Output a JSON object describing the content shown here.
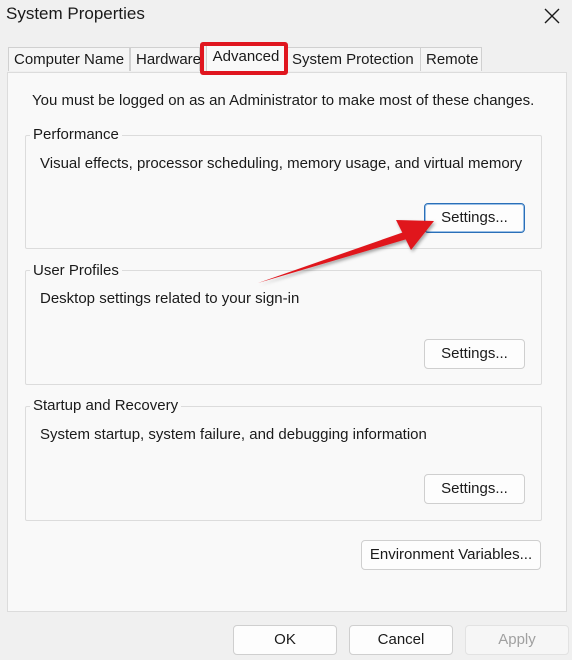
{
  "window": {
    "title": "System Properties"
  },
  "tabs": [
    {
      "label": "Computer Name"
    },
    {
      "label": "Hardware"
    },
    {
      "label": "Advanced"
    },
    {
      "label": "System Protection"
    },
    {
      "label": "Remote"
    }
  ],
  "active_tab": "Advanced",
  "admin_note": "You must be logged on as an Administrator to make most of these changes.",
  "groups": {
    "performance": {
      "label": "Performance",
      "description": "Visual effects, processor scheduling, memory usage, and virtual memory",
      "button": "Settings..."
    },
    "user_profiles": {
      "label": "User Profiles",
      "description": "Desktop settings related to your sign-in",
      "button": "Settings..."
    },
    "startup_recovery": {
      "label": "Startup and Recovery",
      "description": "System startup, system failure, and debugging information",
      "button": "Settings..."
    }
  },
  "environment_button": "Environment Variables...",
  "footer": {
    "ok": "OK",
    "cancel": "Cancel",
    "apply": "Apply"
  },
  "annotation": {
    "highlight_color": "#e0161f",
    "arrow_color": "#e0161f"
  },
  "icons": {
    "close": "close-icon"
  }
}
